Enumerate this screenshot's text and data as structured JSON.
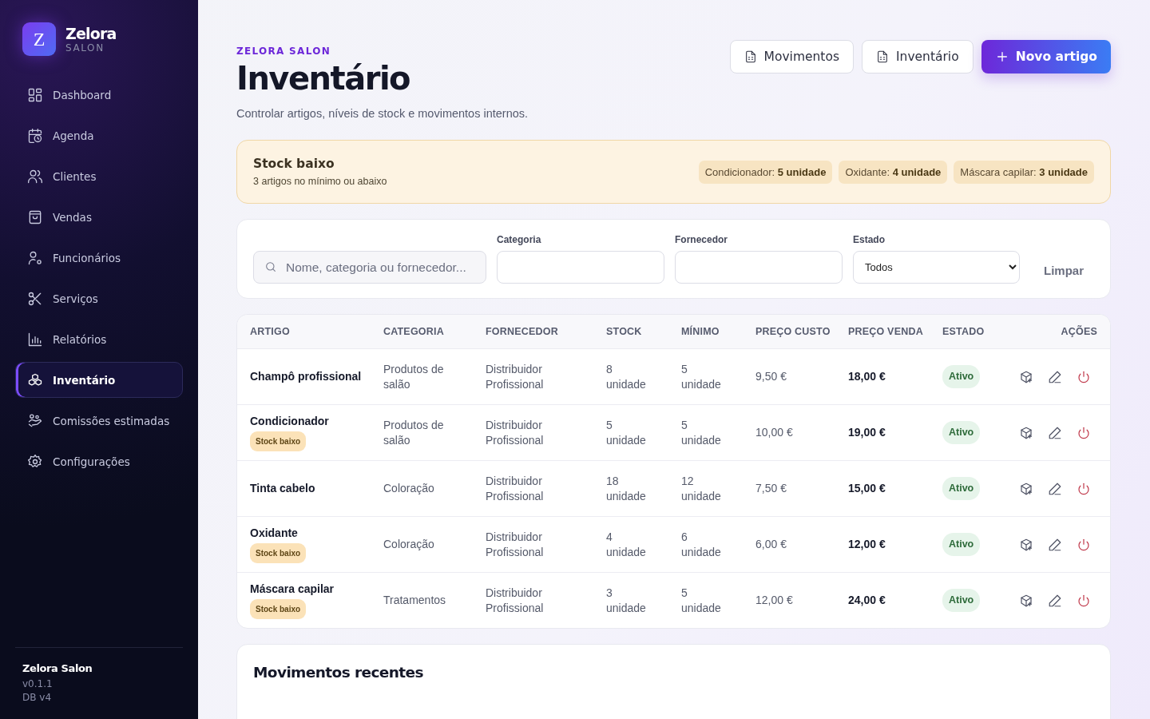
{
  "brand": {
    "logo_letter": "Z",
    "name": "Zelora",
    "subtitle": "SALON"
  },
  "sidebar": {
    "items": [
      {
        "label": "Dashboard",
        "selected": false
      },
      {
        "label": "Agenda",
        "selected": false
      },
      {
        "label": "Clientes",
        "selected": false
      },
      {
        "label": "Vendas",
        "selected": false
      },
      {
        "label": "Funcionários",
        "selected": false
      },
      {
        "label": "Serviços",
        "selected": false
      },
      {
        "label": "Relatórios",
        "selected": false
      },
      {
        "label": "Inventário",
        "selected": true
      },
      {
        "label": "Comissões estimadas",
        "selected": false
      },
      {
        "label": "Configurações",
        "selected": false
      }
    ],
    "footer": {
      "name": "Zelora Salon",
      "version": "v0.1.1",
      "db": "DB v4"
    }
  },
  "header": {
    "eyebrow": "ZELORA SALON",
    "title": "Inventário",
    "subtitle": "Controlar artigos, níveis de stock e movimentos internos.",
    "buttons": [
      {
        "label": "Movimentos",
        "kind": "doc"
      },
      {
        "label": "Inventário",
        "kind": "doc"
      },
      {
        "label": "Novo artigo",
        "kind": "primary"
      }
    ]
  },
  "alert": {
    "title": "Stock baixo",
    "text": "3 artigos no mínimo ou abaixo",
    "chips": [
      "Condicionador: **5 unidade**",
      "Oxidante: **4 unidade**",
      "Máscara capilar: **3 unidade**"
    ]
  },
  "filters": {
    "search": {
      "placeholder": "Nome, categoria ou fornecedor..."
    },
    "category": {
      "label": "Categoria"
    },
    "supplier": {
      "label": "Fornecedor"
    },
    "status": {
      "label": "Estado",
      "value": "Todos"
    },
    "clear": "Limpar"
  },
  "table": {
    "columns": [
      "ARTIGO",
      "CATEGORIA",
      "FORNECEDOR",
      "STOCK",
      "MÍNIMO",
      "PREÇO CUSTO",
      "PREÇO VENDA",
      "ESTADO",
      "AÇÕES"
    ],
    "rows": [
      {
        "name": "Champô profissional",
        "category": "Produtos de salão",
        "supplier": "Distribuidor Profissional",
        "stock": "8 unidade",
        "minimum": "5 unidade",
        "cost": "9,50 €",
        "price": "18,00 €",
        "status": "Ativo",
        "active": true
      },
      {
        "name": "Condicionador",
        "badge": "Stock baixo",
        "category": "Produtos de salão",
        "supplier": "Distribuidor Profissional",
        "stock": "5 unidade",
        "minimum": "5 unidade",
        "cost": "10,00 €",
        "price": "19,00 €",
        "status": "Ativo",
        "active": true
      },
      {
        "name": "Tinta cabelo",
        "category": "Coloração",
        "supplier": "Distribuidor Profissional",
        "stock": "18 unidade",
        "minimum": "12 unidade",
        "cost": "7,50 €",
        "price": "15,00 €",
        "status": "Ativo",
        "active": true
      },
      {
        "name": "Oxidante",
        "badge": "Stock baixo",
        "category": "Coloração",
        "supplier": "Distribuidor Profissional",
        "stock": "4 unidade",
        "minimum": "6 unidade",
        "cost": "6,00 €",
        "price": "12,00 €",
        "status": "Ativo",
        "active": true
      },
      {
        "name": "Máscara capilar",
        "badge": "Stock baixo",
        "category": "Tratamentos",
        "supplier": "Distribuidor Profissional",
        "stock": "3 unidade",
        "minimum": "5 unidade",
        "cost": "12,00 €",
        "price": "24,00 €",
        "status": "Ativo",
        "active": true
      }
    ]
  },
  "movements": {
    "title": "Movimentos recentes"
  }
}
